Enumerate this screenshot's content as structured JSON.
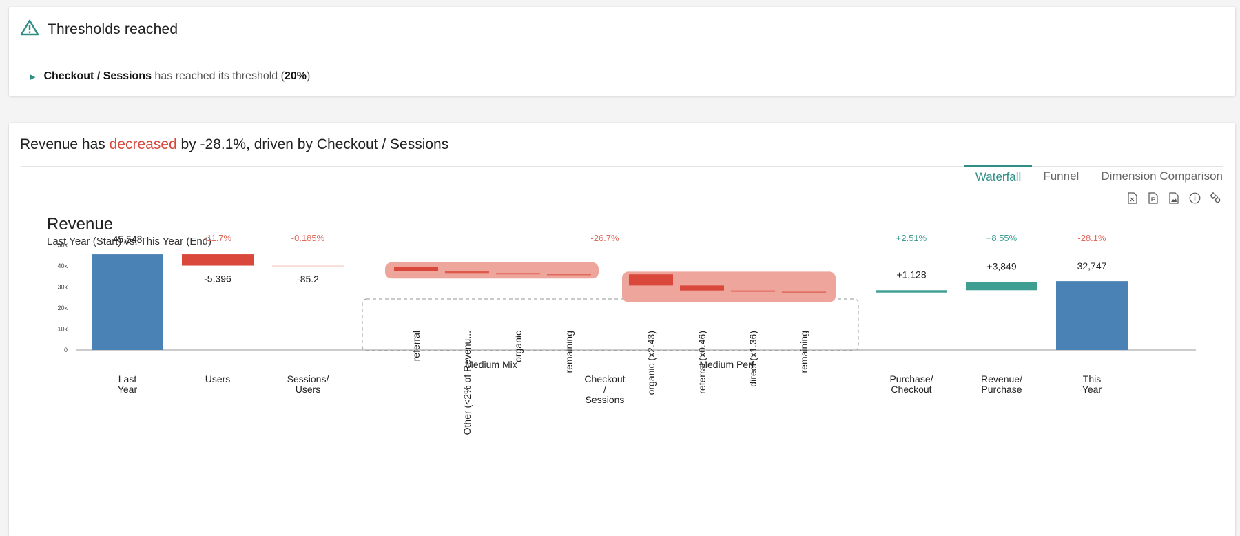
{
  "alert": {
    "title": "Thresholds reached",
    "metric": "Checkout / Sessions",
    "message": "has reached its threshold (",
    "threshold": "20%",
    "close_paren": ")"
  },
  "insight": {
    "prefix": "Revenue has",
    "direction": "decreased",
    "suffix": "by -28.1%, driven by Checkout / Sessions"
  },
  "tabs": [
    {
      "label": "Waterfall",
      "active": true
    },
    {
      "label": "Funnel",
      "active": false
    },
    {
      "label": "Dimension Comparison",
      "active": false
    }
  ],
  "toolbar": [
    "excel-export-icon",
    "pdf-export-icon",
    "image-export-icon",
    "info-icon",
    "settings-icon"
  ],
  "colors": {
    "accent": "#2f8f86",
    "start_end": "#4a82b5",
    "negative": "#d9483b",
    "positive": "#3f9e92",
    "group_highlight": "#eea59c"
  },
  "chart_data": {
    "type": "waterfall",
    "title": "Revenue",
    "subtitle": "Last Year (Start) vs. This Year (End)",
    "y_ticks": [
      "0",
      "10k",
      "20k",
      "30k",
      "40k",
      "50k"
    ],
    "ylim": [
      0,
      50000
    ],
    "steps": [
      {
        "label": "Last\nYear",
        "kind": "total",
        "value": 45548,
        "value_label": "45,548"
      },
      {
        "label": "Users",
        "kind": "delta",
        "value": -5396,
        "value_label": "-5,396",
        "pct": "-11.7%"
      },
      {
        "label": "Sessions/\nUsers",
        "kind": "delta",
        "value": -85.2,
        "value_label": "-85.2",
        "pct": "-0.185%"
      },
      {
        "label": "Checkout\n/\nSessions",
        "kind": "group",
        "pct": "-26.7%",
        "groups": [
          {
            "label": "Medium Mix",
            "items": [
              {
                "label": "referral",
                "start": 39500,
                "end": 37400
              },
              {
                "label": "Other (<2% of Revenu...",
                "start": 37400,
                "end": 36600
              },
              {
                "label": "organic",
                "start": 36600,
                "end": 36000
              },
              {
                "label": "remaining",
                "start": 36000,
                "end": 35700
              }
            ]
          },
          {
            "label": "Medium Perf",
            "items": [
              {
                "label": "organic (x2.43)",
                "start": 36000,
                "end": 30700
              },
              {
                "label": "referral (x0.46)",
                "start": 30700,
                "end": 28300
              },
              {
                "label": "direct (x1.36)",
                "start": 28300,
                "end": 27700
              },
              {
                "label": "remaining",
                "start": 27700,
                "end": 27300
              }
            ]
          }
        ]
      },
      {
        "label": "Purchase/\nCheckout",
        "kind": "delta",
        "value": 1128,
        "value_label": "+1,128",
        "pct": "+2.51%"
      },
      {
        "label": "Revenue/\nPurchase",
        "kind": "delta",
        "value": 3849,
        "value_label": "+3,849",
        "pct": "+8.55%"
      },
      {
        "label": "This\nYear",
        "kind": "total",
        "value": 32747,
        "value_label": "32,747",
        "pct": "-28.1%"
      }
    ]
  }
}
